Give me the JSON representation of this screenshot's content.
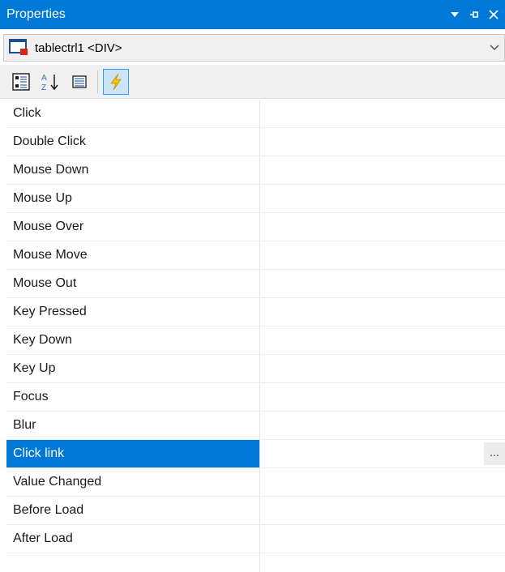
{
  "window": {
    "title": "Properties"
  },
  "titlebar_icons": [
    "dropdown-arrow-icon",
    "pin-icon",
    "close-icon"
  ],
  "object_selector": {
    "value": "tablectrl1 <DIV>"
  },
  "toolbar": {
    "buttons": [
      {
        "icon": "categorized-icon",
        "active": false
      },
      {
        "icon": "alphabetical-sort-icon",
        "active": false
      },
      {
        "icon": "properties-page-icon",
        "active": false
      },
      {
        "icon": "events-lightning-icon",
        "active": true
      }
    ]
  },
  "events": [
    {
      "name": "Click",
      "value": ""
    },
    {
      "name": "Double Click",
      "value": ""
    },
    {
      "name": "Mouse Down",
      "value": ""
    },
    {
      "name": "Mouse Up",
      "value": ""
    },
    {
      "name": "Mouse Over",
      "value": ""
    },
    {
      "name": "Mouse Move",
      "value": ""
    },
    {
      "name": "Mouse Out",
      "value": ""
    },
    {
      "name": "Key Pressed",
      "value": ""
    },
    {
      "name": "Key Down",
      "value": ""
    },
    {
      "name": "Key Up",
      "value": ""
    },
    {
      "name": "Focus",
      "value": ""
    },
    {
      "name": "Blur",
      "value": ""
    },
    {
      "name": "Click link",
      "value": "",
      "selected": true,
      "ellipsis": "..."
    },
    {
      "name": "Value Changed",
      "value": ""
    },
    {
      "name": "Before Load",
      "value": ""
    },
    {
      "name": "After Load",
      "value": ""
    }
  ],
  "colors": {
    "accent": "#0078d7",
    "toolbar_bg": "#f0f0f0"
  }
}
